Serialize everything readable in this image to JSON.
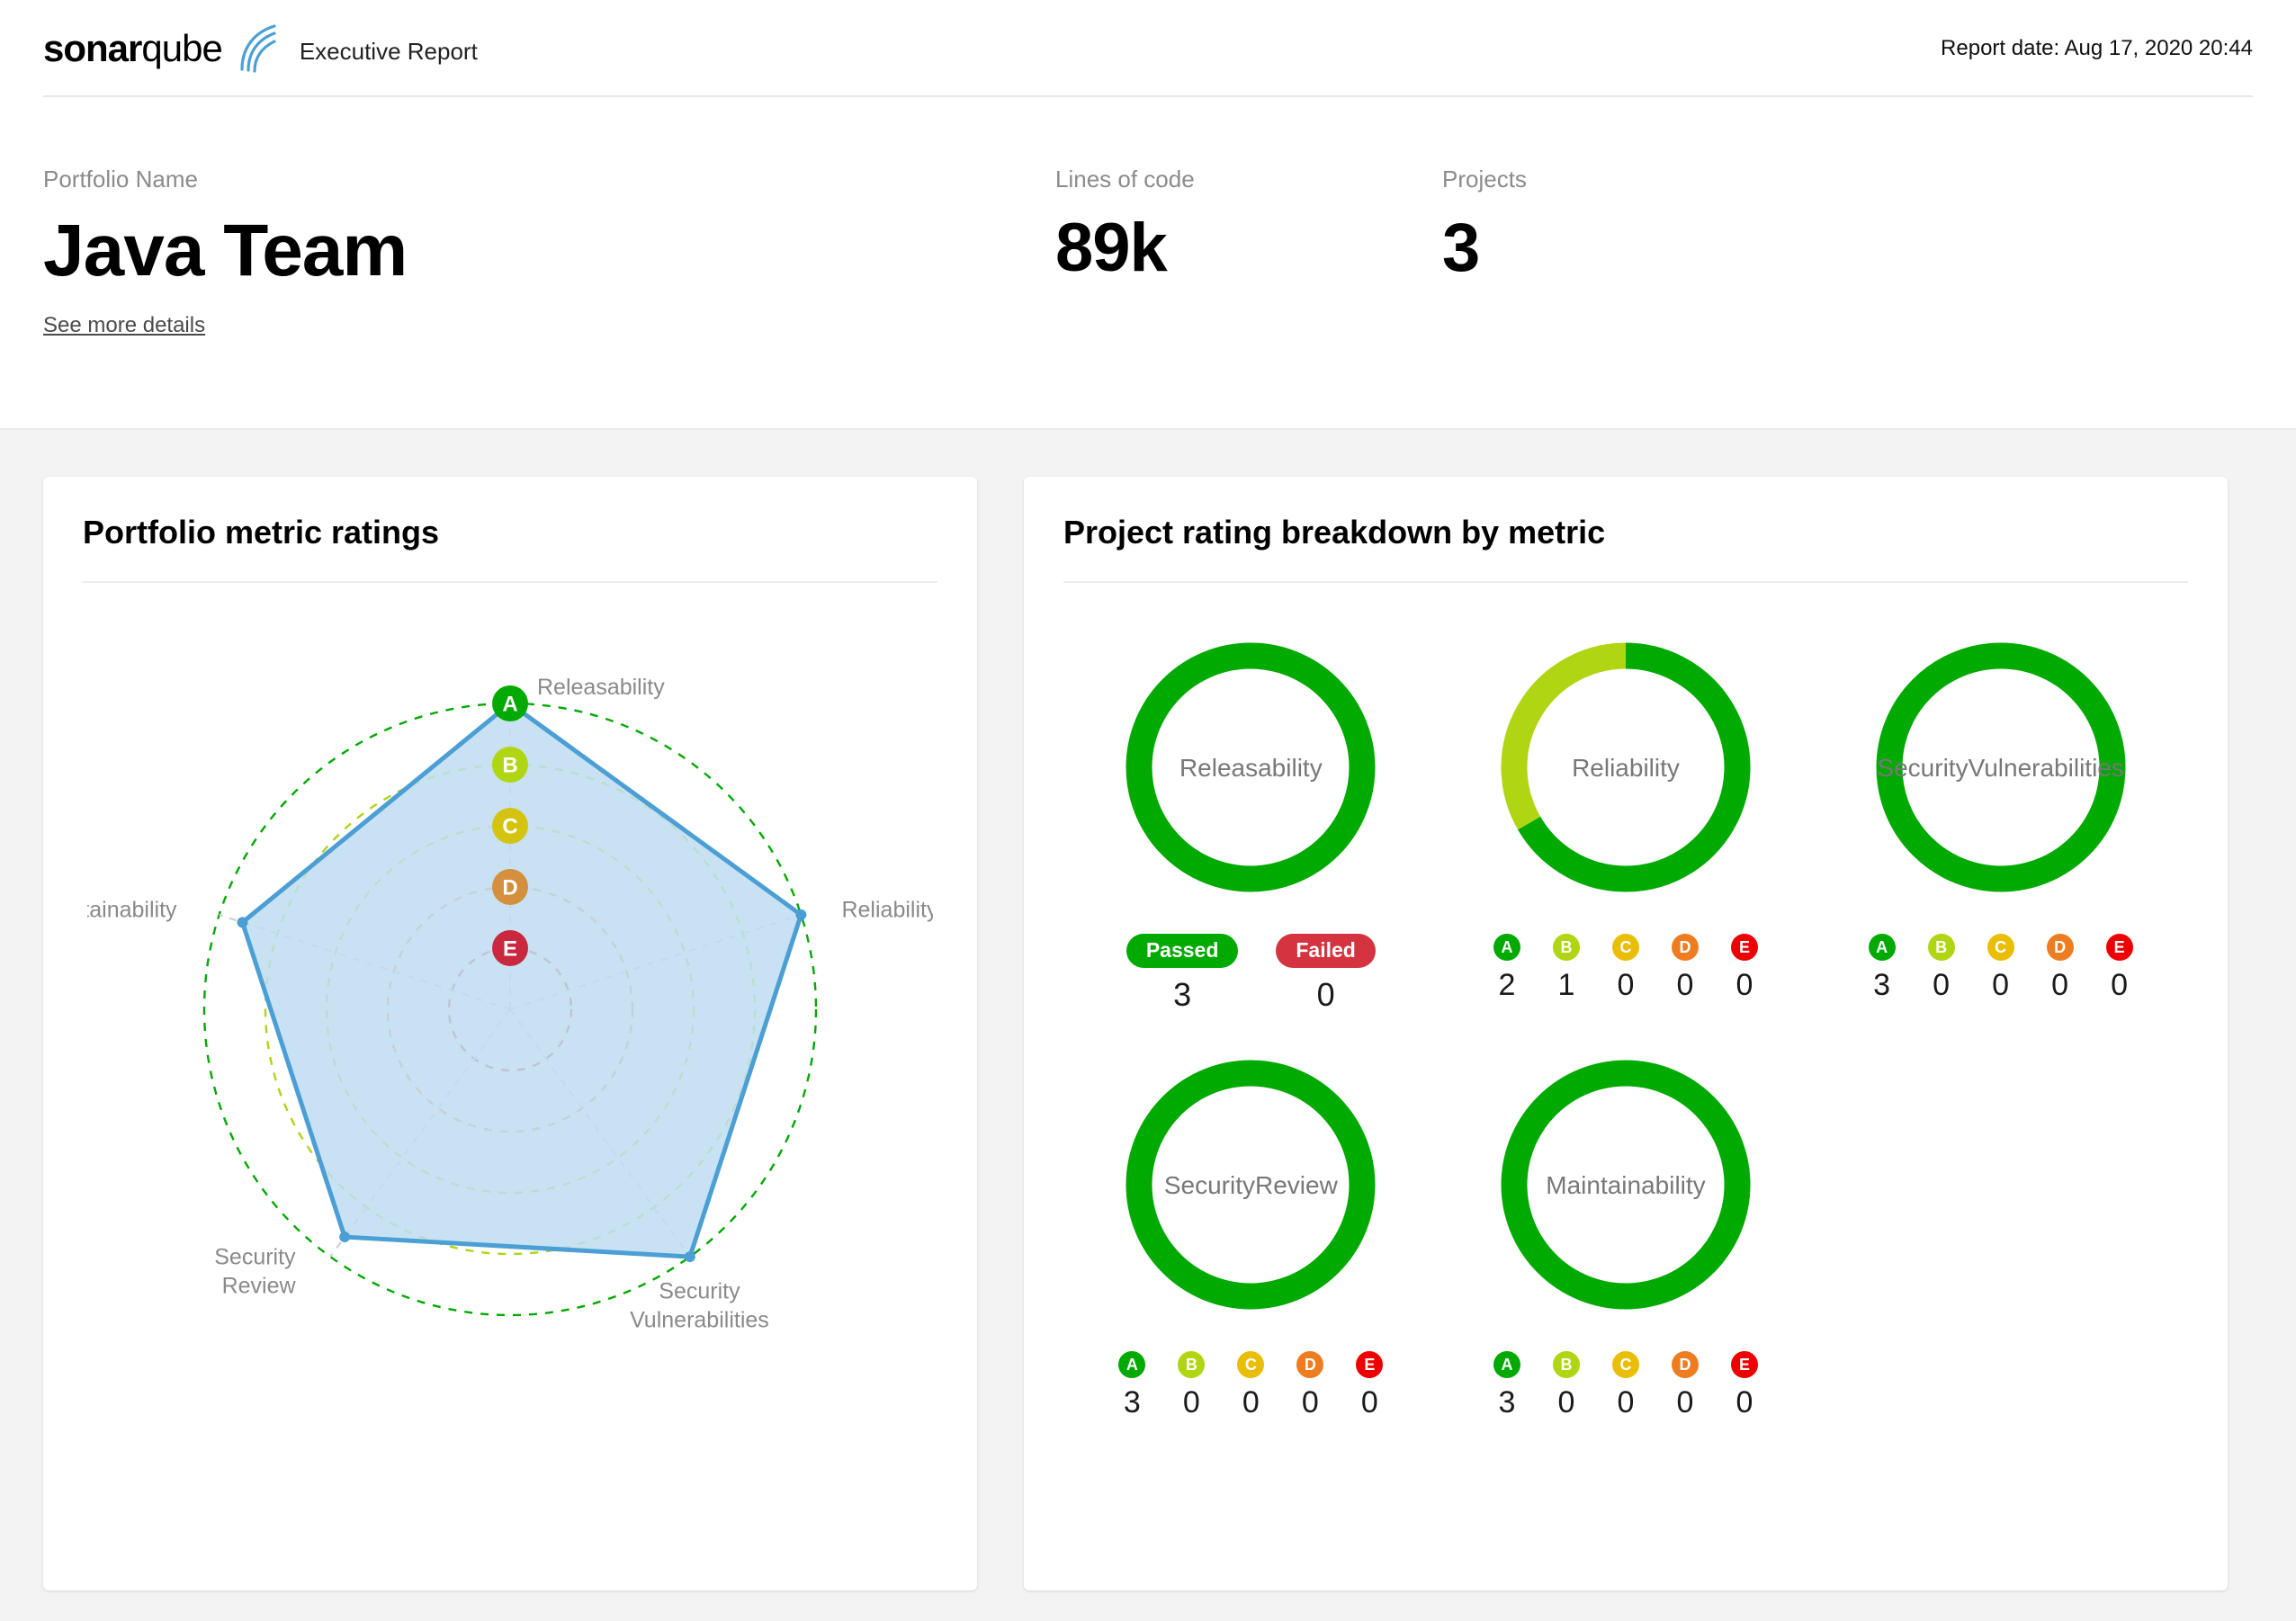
{
  "header": {
    "logo_primary": "sonar",
    "logo_secondary": "qube",
    "logo_icon": "sonar-wave-icon",
    "subtitle": "Executive Report",
    "report_date": "Report date: Aug 17, 2020 20:44"
  },
  "summary": {
    "portfolio_label": "Portfolio Name",
    "portfolio_name": "Java Team",
    "see_more_link": "See more details",
    "loc_label": "Lines of code",
    "loc_value": "89k",
    "projects_label": "Projects",
    "projects_value": "3"
  },
  "cards": {
    "radar_title": "Portfolio metric ratings",
    "breakdown_title": "Project rating breakdown by metric"
  },
  "rating_colors": {
    "A": "#00AA00",
    "B": "#B0D513",
    "C": "#EABE06",
    "D": "#ED7D20",
    "E": "#EE0000",
    "A_radar": "#00AA00",
    "B_radar": "#B0D513",
    "C_radar": "#D4C40F",
    "D_radar": "#D4903C",
    "E_radar": "#C9283E",
    "passed": "#00AA00",
    "failed": "#D4333F",
    "radar_line": "#4B9FD5",
    "radar_fill": "#BEDDF1",
    "spoke": "#cccccc"
  },
  "chart_data": [
    {
      "type": "radar",
      "title": "Portfolio metric ratings",
      "axes": [
        "Releasability",
        "Reliability",
        "Security Vulnerabilities",
        "Security Review",
        "Maintainability"
      ],
      "rings": [
        "A",
        "B",
        "C",
        "D",
        "E"
      ],
      "ring_levels": [
        5,
        4,
        3,
        2,
        1
      ],
      "ring_label_axis": "top",
      "series": [
        {
          "name": "Java Team",
          "values": [
            5,
            5,
            5,
            4.6,
            4.6
          ],
          "value_ratings": [
            "A",
            "A",
            "A",
            "A",
            "A"
          ]
        }
      ],
      "legend": "none",
      "grid": "dashed-concentric"
    },
    {
      "type": "pie",
      "subtype": "donut",
      "title": "Releasability",
      "categories": [
        "Passed",
        "Failed"
      ],
      "values": [
        3,
        0
      ],
      "colors": [
        "#00AA00",
        "#D4333F"
      ]
    },
    {
      "type": "pie",
      "subtype": "donut",
      "title": "Reliability",
      "categories": [
        "A",
        "B",
        "C",
        "D",
        "E"
      ],
      "values": [
        2,
        1,
        0,
        0,
        0
      ],
      "colors": [
        "#00AA00",
        "#B0D513",
        "#EABE06",
        "#ED7D20",
        "#EE0000"
      ]
    },
    {
      "type": "pie",
      "subtype": "donut",
      "title": "Security Vulnerabilities",
      "categories": [
        "A",
        "B",
        "C",
        "D",
        "E"
      ],
      "values": [
        3,
        0,
        0,
        0,
        0
      ],
      "colors": [
        "#00AA00",
        "#B0D513",
        "#EABE06",
        "#ED7D20",
        "#EE0000"
      ]
    },
    {
      "type": "pie",
      "subtype": "donut",
      "title": "Security Review",
      "categories": [
        "A",
        "B",
        "C",
        "D",
        "E"
      ],
      "values": [
        3,
        0,
        0,
        0,
        0
      ],
      "colors": [
        "#00AA00",
        "#B0D513",
        "#EABE06",
        "#ED7D20",
        "#EE0000"
      ]
    },
    {
      "type": "pie",
      "subtype": "donut",
      "title": "Maintainability",
      "categories": [
        "A",
        "B",
        "C",
        "D",
        "E"
      ],
      "values": [
        3,
        0,
        0,
        0,
        0
      ],
      "colors": [
        "#00AA00",
        "#B0D513",
        "#EABE06",
        "#ED7D20",
        "#EE0000"
      ]
    }
  ],
  "donuts": [
    {
      "key": "releasability",
      "label": "Releasability",
      "legend_type": "passfail",
      "segments": [
        {
          "label": "Passed",
          "value": 3,
          "color": "#00AA00"
        },
        {
          "label": "Failed",
          "value": 0,
          "color": "#D4333F"
        }
      ]
    },
    {
      "key": "reliability",
      "label": "Reliability",
      "legend_type": "rating",
      "segments": [
        {
          "label": "A",
          "value": 2,
          "color": "#00AA00"
        },
        {
          "label": "B",
          "value": 1,
          "color": "#B0D513"
        },
        {
          "label": "C",
          "value": 0,
          "color": "#EABE06"
        },
        {
          "label": "D",
          "value": 0,
          "color": "#ED7D20"
        },
        {
          "label": "E",
          "value": 0,
          "color": "#EE0000"
        }
      ]
    },
    {
      "key": "security-vulnerabilities",
      "label": "Security\nVulnerabilities",
      "legend_type": "rating",
      "segments": [
        {
          "label": "A",
          "value": 3,
          "color": "#00AA00"
        },
        {
          "label": "B",
          "value": 0,
          "color": "#B0D513"
        },
        {
          "label": "C",
          "value": 0,
          "color": "#EABE06"
        },
        {
          "label": "D",
          "value": 0,
          "color": "#ED7D20"
        },
        {
          "label": "E",
          "value": 0,
          "color": "#EE0000"
        }
      ]
    },
    {
      "key": "security-review",
      "label": "Security\nReview",
      "legend_type": "rating",
      "segments": [
        {
          "label": "A",
          "value": 3,
          "color": "#00AA00"
        },
        {
          "label": "B",
          "value": 0,
          "color": "#B0D513"
        },
        {
          "label": "C",
          "value": 0,
          "color": "#EABE06"
        },
        {
          "label": "D",
          "value": 0,
          "color": "#ED7D20"
        },
        {
          "label": "E",
          "value": 0,
          "color": "#EE0000"
        }
      ]
    },
    {
      "key": "maintainability",
      "label": "Maintainability",
      "legend_type": "rating",
      "segments": [
        {
          "label": "A",
          "value": 3,
          "color": "#00AA00"
        },
        {
          "label": "B",
          "value": 0,
          "color": "#B0D513"
        },
        {
          "label": "C",
          "value": 0,
          "color": "#EABE06"
        },
        {
          "label": "D",
          "value": 0,
          "color": "#ED7D20"
        },
        {
          "label": "E",
          "value": 0,
          "color": "#EE0000"
        }
      ]
    }
  ]
}
